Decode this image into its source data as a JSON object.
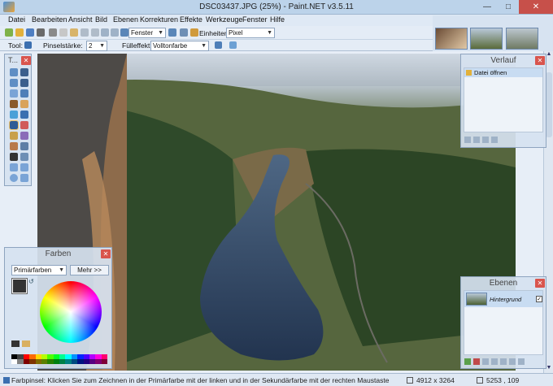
{
  "window": {
    "title": "DSC03437.JPG (25%) - Paint.NET v3.5.11",
    "minimize": "—",
    "maximize": "□",
    "close": "✕"
  },
  "menu": {
    "items": [
      "Datei",
      "Bearbeiten",
      "Ansicht",
      "Bild",
      "Ebenen",
      "Korrekturen",
      "Effekte",
      "Werkzeuge",
      "Fenster",
      "Hilfe"
    ]
  },
  "toolbar1": {
    "zoom_value": "Fenster",
    "units_label": "Einheiten:",
    "units_value": "Pixel"
  },
  "toolbar2": {
    "tool_label": "Tool:",
    "brush_width_label": "Pinselstärke:",
    "brush_width_value": "2",
    "fill_label": "Fülleffekt:",
    "fill_value": "Volltonfarbe"
  },
  "panels": {
    "tools": {
      "title": "T..."
    },
    "history": {
      "title": "Verlauf",
      "items": [
        "Datei öffnen"
      ]
    },
    "colors": {
      "title": "Farben",
      "mode_value": "Primärfarben",
      "more_button": "Mehr >>"
    },
    "layers": {
      "title": "Ebenen",
      "items": [
        "Hintergrund"
      ]
    }
  },
  "status": {
    "hint": "Farbpinsel: Klicken Sie zum Zeichnen in der Primärfarbe mit der linken und in der Sekundärfarbe mit der rechten Maustaste",
    "image_size": "4912 x 3264",
    "cursor_pos": "5253 , 109"
  }
}
